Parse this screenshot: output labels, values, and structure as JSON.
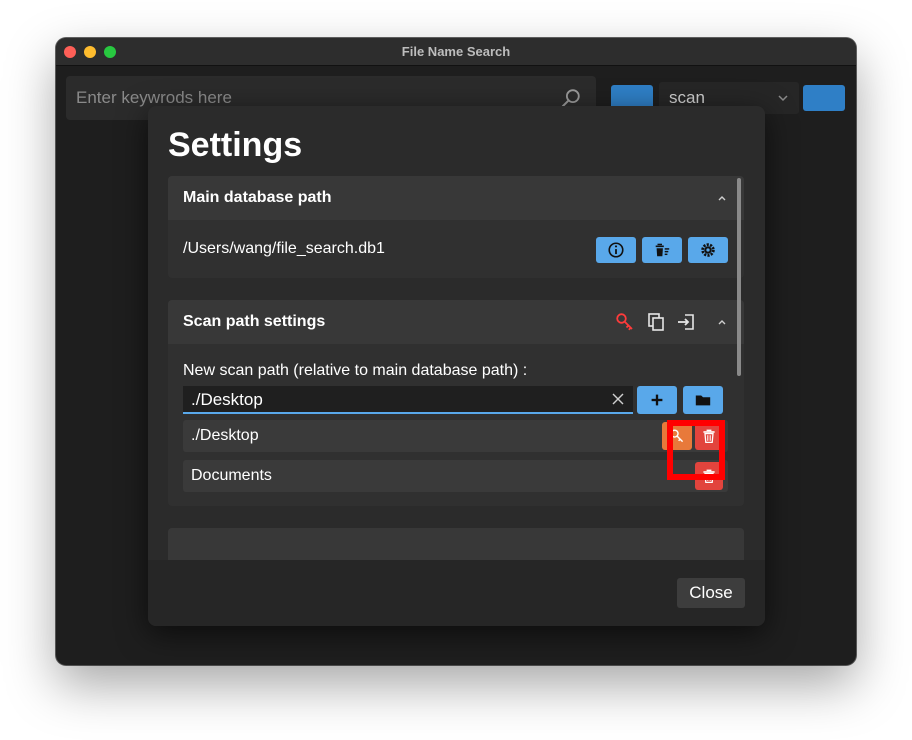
{
  "window": {
    "title": "File Name Search"
  },
  "search": {
    "placeholder": "Enter keywrods here"
  },
  "scan_select": {
    "value": "scan"
  },
  "dialog": {
    "title": "Settings",
    "main_db": {
      "title": "Main database path",
      "path": "/Users/wang/file_search.db1"
    },
    "scan_paths": {
      "title": "Scan path settings",
      "new_label": "New scan path (relative to main database path) :",
      "input_value": "./Desktop",
      "items": [
        {
          "label": "./Desktop"
        },
        {
          "label": "Documents"
        }
      ]
    },
    "close_label": "Close"
  },
  "colors": {
    "accent_blue": "#59a8ea",
    "danger_red": "#e2443d",
    "key_orange": "#e8793a",
    "highlight_red": "#ff0000"
  }
}
